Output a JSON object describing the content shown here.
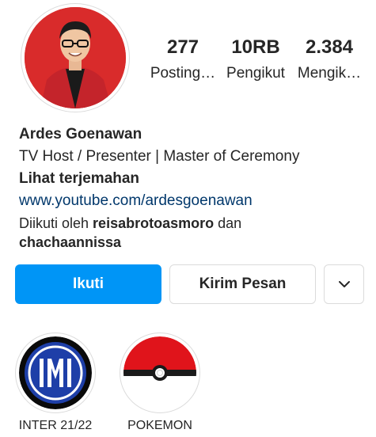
{
  "profile": {
    "name": "Ardes Goenawan",
    "category": "TV Host / Presenter | Master of Ceremony",
    "translate": "Lihat terjemahan",
    "website": "www.youtube.com/ardesgoenawan",
    "followed_prefix": "Diikuti oleh ",
    "followed_user1": "reisabrotoasmoro",
    "followed_and": " dan",
    "followed_user2": "chachaannissa"
  },
  "stats": {
    "posts": {
      "value": "277",
      "label": "Posting…"
    },
    "followers": {
      "value": "10RB",
      "label": "Pengikut"
    },
    "following": {
      "value": "2.384",
      "label": "Mengik…"
    }
  },
  "actions": {
    "follow": "Ikuti",
    "message": "Kirim Pesan"
  },
  "highlights": [
    {
      "title": "INTER 21/22",
      "icon": "inter-logo-icon"
    },
    {
      "title": "POKEMON",
      "icon": "pokeball-icon"
    }
  ],
  "colors": {
    "primary_button": "#0095f6",
    "link": "#00376b",
    "avatar_background": "#d92b2b"
  }
}
